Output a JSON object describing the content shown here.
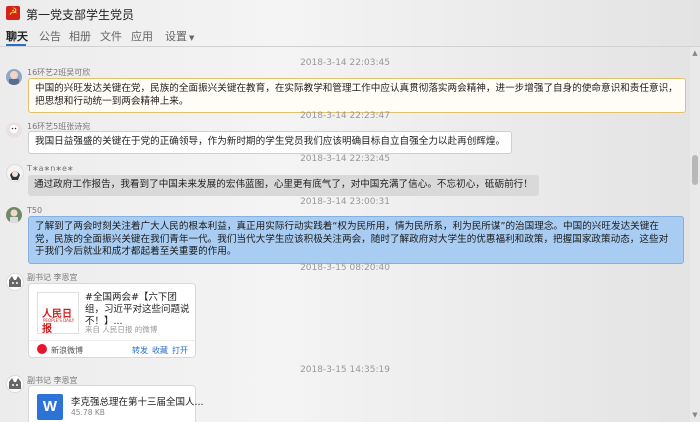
{
  "app": {
    "title": "第一党支部学生党员"
  },
  "tabs": [
    "聊天",
    "公告",
    "相册",
    "文件",
    "应用",
    "设置"
  ],
  "messages": [
    {
      "time": "2018-3-14 22:03:45",
      "sender": "16环艺2班吴可欣",
      "text": "中国的兴旺发达关键在党，民族的全面振兴关键在教育，在实际教学和管理工作中应认真贯彻落实两会精神，进一步增强了自身的使命意识和责任意识，把思想和行动统一到两会精神上来。"
    },
    {
      "time": "2018-3-14 22:23:47",
      "sender": "16环艺5班张诗宛",
      "text": "我国日益强盛的关键在于党的正确领导，作为新时期的学生党员我们应该明确目标自立自强全力以赴再创辉煌。"
    },
    {
      "time": "2018-3-14 22:32:45",
      "sender": "T∗a∗n∗e∗",
      "text": "通过政府工作报告，我看到了中国未来发展的宏伟蓝图，心里更有底气了，对中国充满了信心。不忘初心，砥砺前行！"
    },
    {
      "time": "2018-3-14 23:00:31",
      "sender": "T50",
      "text": "了解到了两会时刻关注着广大人民的根本利益，真正用实际行动实践着“权为民所用，情为民所系，利为民所谋”的治国理念。中国的兴旺发达关键在党，民族的全面振兴关键在我们青年一代。我们当代大学生应该积极关注两会，随时了解政府对大学生的优惠福利和政策，把握国家政策动态，这些对于我们今后就业和成才都起着至关重要的作用。"
    },
    {
      "time": "2018-3-15 08:20:40",
      "sender": "副书记 李恩宜",
      "card": {
        "thumb": "人民日报",
        "thumb_sub": "PEOPLE'S DAILY",
        "text": "#全国两会#【六下团组，习近平对这些问题说不！】...",
        "source": "来自 人民日报 的微博",
        "platform": "新浪微博",
        "actions": [
          "转发",
          "收藏",
          "打开"
        ]
      }
    },
    {
      "time": "2018-3-15 14:35:19",
      "sender": "副书记 李恩宜",
      "file": {
        "icon_letter": "W",
        "name": "李克强总理在第十三届全国人...",
        "size": "45.78 KB"
      }
    }
  ]
}
